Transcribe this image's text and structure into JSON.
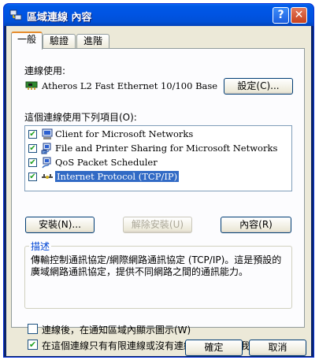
{
  "window": {
    "title": "區域連線 內容",
    "help_glyph": "?",
    "close_glyph": "✕"
  },
  "tabs": [
    {
      "label": "一般",
      "active": true
    },
    {
      "label": "驗證",
      "active": false
    },
    {
      "label": "進階",
      "active": false
    }
  ],
  "connect_using": {
    "label": "連線使用:",
    "adapter": "Atheros L2 Fast Ethernet 10/100 Base",
    "configure_button": "設定(C)..."
  },
  "components": {
    "label": "這個連線使用下列項目(O):",
    "items": [
      {
        "label": "Client for Microsoft Networks",
        "checked": true,
        "selected": false,
        "icon": "network-client-icon"
      },
      {
        "label": "File and Printer Sharing for Microsoft Networks",
        "checked": true,
        "selected": false,
        "icon": "file-printer-sharing-icon"
      },
      {
        "label": "QoS Packet Scheduler",
        "checked": true,
        "selected": false,
        "icon": "qos-scheduler-icon"
      },
      {
        "label": "Internet Protocol (TCP/IP)",
        "checked": true,
        "selected": true,
        "icon": "protocol-icon"
      }
    ],
    "install_button": "安裝(N)...",
    "uninstall_button": "解除安裝(U)",
    "properties_button": "內容(R)"
  },
  "description": {
    "title": "描述",
    "text": "傳輸控制通訊協定/網際網路通訊協定 (TCP/IP)。這是預設的廣域網路通訊協定，提供不同網路之間的通訊能力。"
  },
  "options": [
    {
      "label": "連線後，在通知區域內顯示圖示(W)",
      "checked": false
    },
    {
      "label": "在這個連線只有有限連線或沒有連線能力時通知我(M)",
      "checked": true
    }
  ],
  "footer": {
    "ok_button": "確定",
    "cancel_button": "取消"
  },
  "colors": {
    "title_bar": "#0054e3",
    "dialog_bg": "#ece9d8",
    "selection": "#316ac5",
    "tab_accent": "#e68b2c"
  }
}
